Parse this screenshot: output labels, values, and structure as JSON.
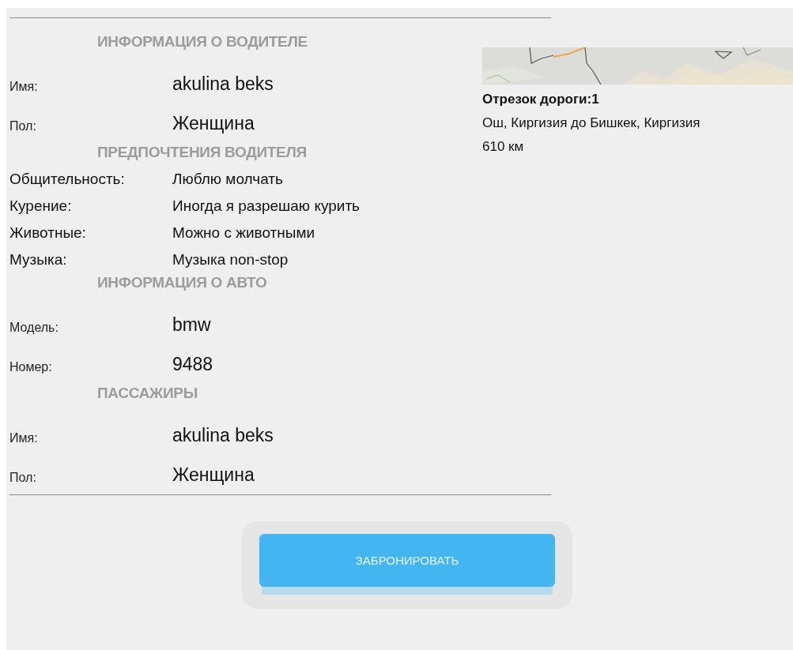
{
  "sections": [
    {
      "heading": "ИНФОРМАЦИЯ О ВОДИТЕЛЕ",
      "kind": "details",
      "rows": [
        {
          "label": "Имя:",
          "value": "akulina beks"
        },
        {
          "label": "Пол:",
          "value": "Женщина"
        }
      ]
    },
    {
      "heading": "ПРЕДПОЧТЕНИЯ ВОДИТЕЛЯ",
      "kind": "compact",
      "rows": [
        {
          "label": "Общительность:",
          "value": "Люблю молчать"
        },
        {
          "label": "Курение:",
          "value": "Иногда я разрешаю курить"
        },
        {
          "label": "Животные:",
          "value": "Можно с животными"
        },
        {
          "label": "Музыка:",
          "value": "Музыка non-stop"
        }
      ]
    },
    {
      "heading": "ИНФОРМАЦИЯ О АВТО",
      "kind": "details",
      "rows": [
        {
          "label": "Модель:",
          "value": "bmw"
        },
        {
          "label": "Номер:",
          "value": "9488"
        }
      ]
    },
    {
      "heading": "ПАССАЖИРЫ",
      "kind": "details",
      "rows": [
        {
          "label": "Имя:",
          "value": "akulina beks"
        },
        {
          "label": "Пол:",
          "value": "Женщина"
        }
      ]
    }
  ],
  "route": {
    "segment_title": "Отрезок дороги:1",
    "route": "Ош, Киргизия до Бишкек, Киргизия",
    "distance": "610 км"
  },
  "book_button": "ЗАБРОНИРОВАТЬ"
}
